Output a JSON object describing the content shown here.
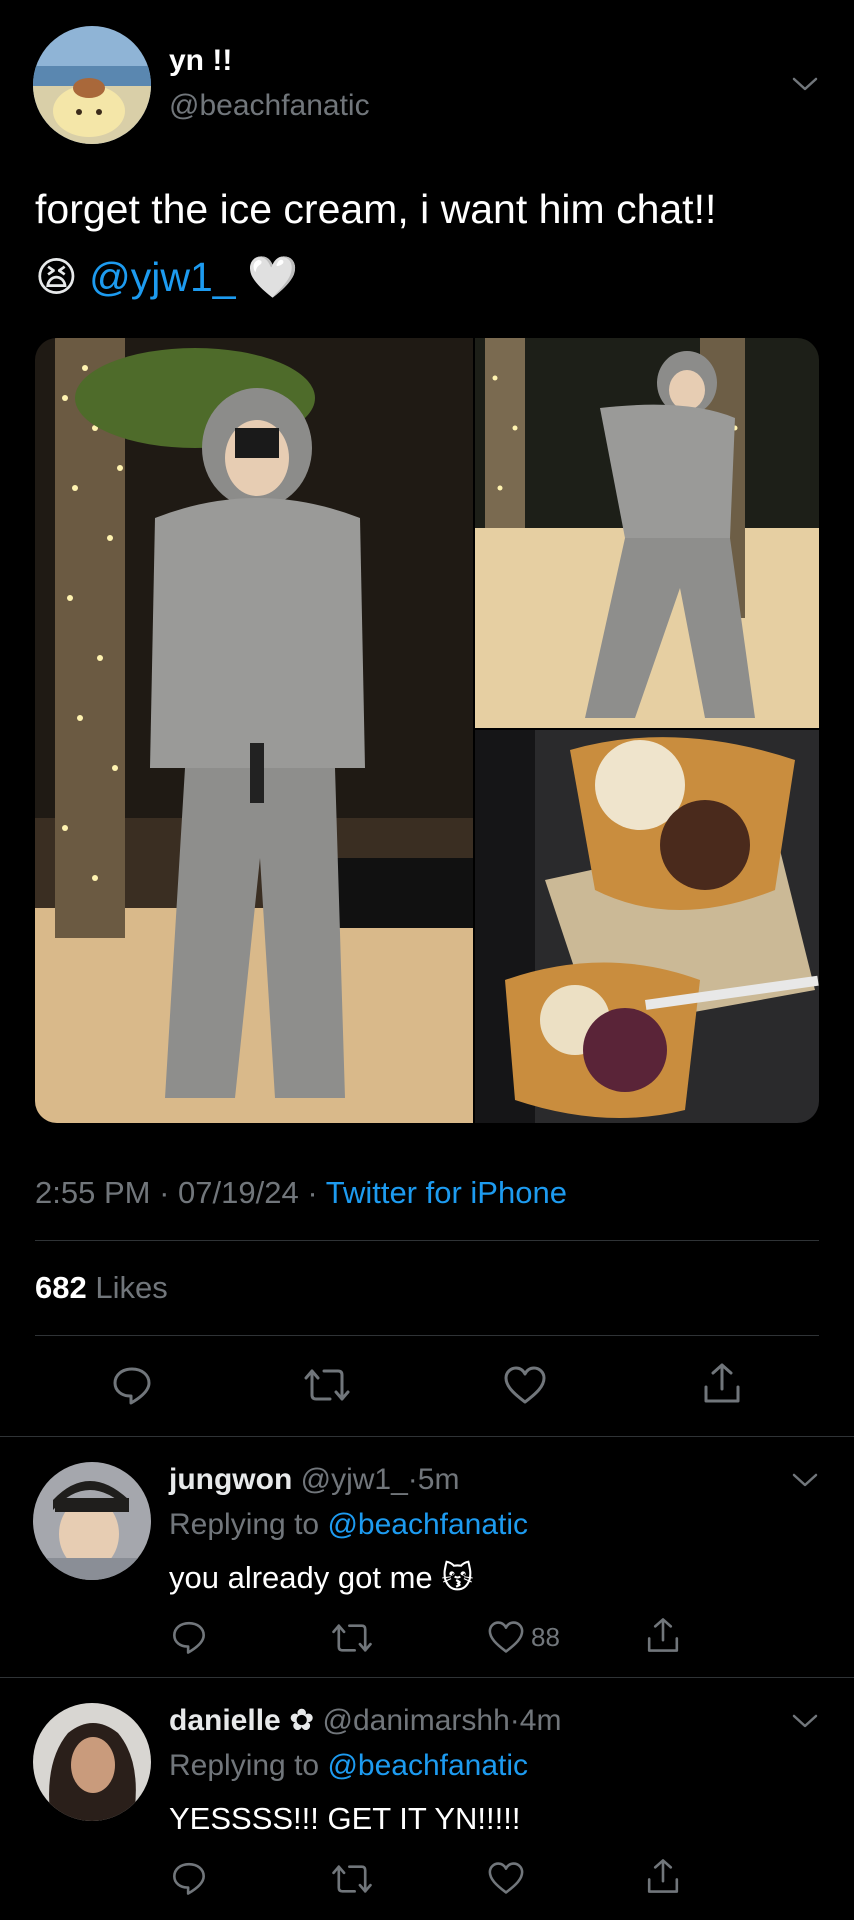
{
  "tweet": {
    "display_name": "yn !!",
    "handle": "@beachfanatic",
    "text_line1": "forget the ice cream, i want him chat!!",
    "mention": "@yjw1_",
    "emoji_1": "😫",
    "emoji_2": "🤍",
    "time": "2:55 PM",
    "date": "07/19/24",
    "source": "Twitter for iPhone",
    "sep": "·",
    "likes_count": "682",
    "likes_label": "Likes"
  },
  "replies": [
    {
      "name": "jungwon",
      "handle": "@yjw1_",
      "time": "5m",
      "replying_prefix": "Replying to",
      "replying_handle": "@beachfanatic",
      "text": "you already got me",
      "emoji": "😽",
      "like_count": "88"
    },
    {
      "name": "danielle",
      "flower": "✿",
      "handle": "@danimarshh",
      "time": "4m",
      "replying_prefix": "Replying to",
      "replying_handle": "@beachfanatic",
      "text": "YESSSS!!! GET IT YN!!!!!",
      "like_count": ""
    }
  ],
  "colors": {
    "background": "#000000",
    "text": "#e7e9ea",
    "muted": "#71767b",
    "accent": "#1d9bf0",
    "divider": "#2f3336"
  },
  "icons": [
    "chevron-down-icon",
    "reply-icon",
    "retweet-icon",
    "like-icon",
    "share-icon"
  ]
}
